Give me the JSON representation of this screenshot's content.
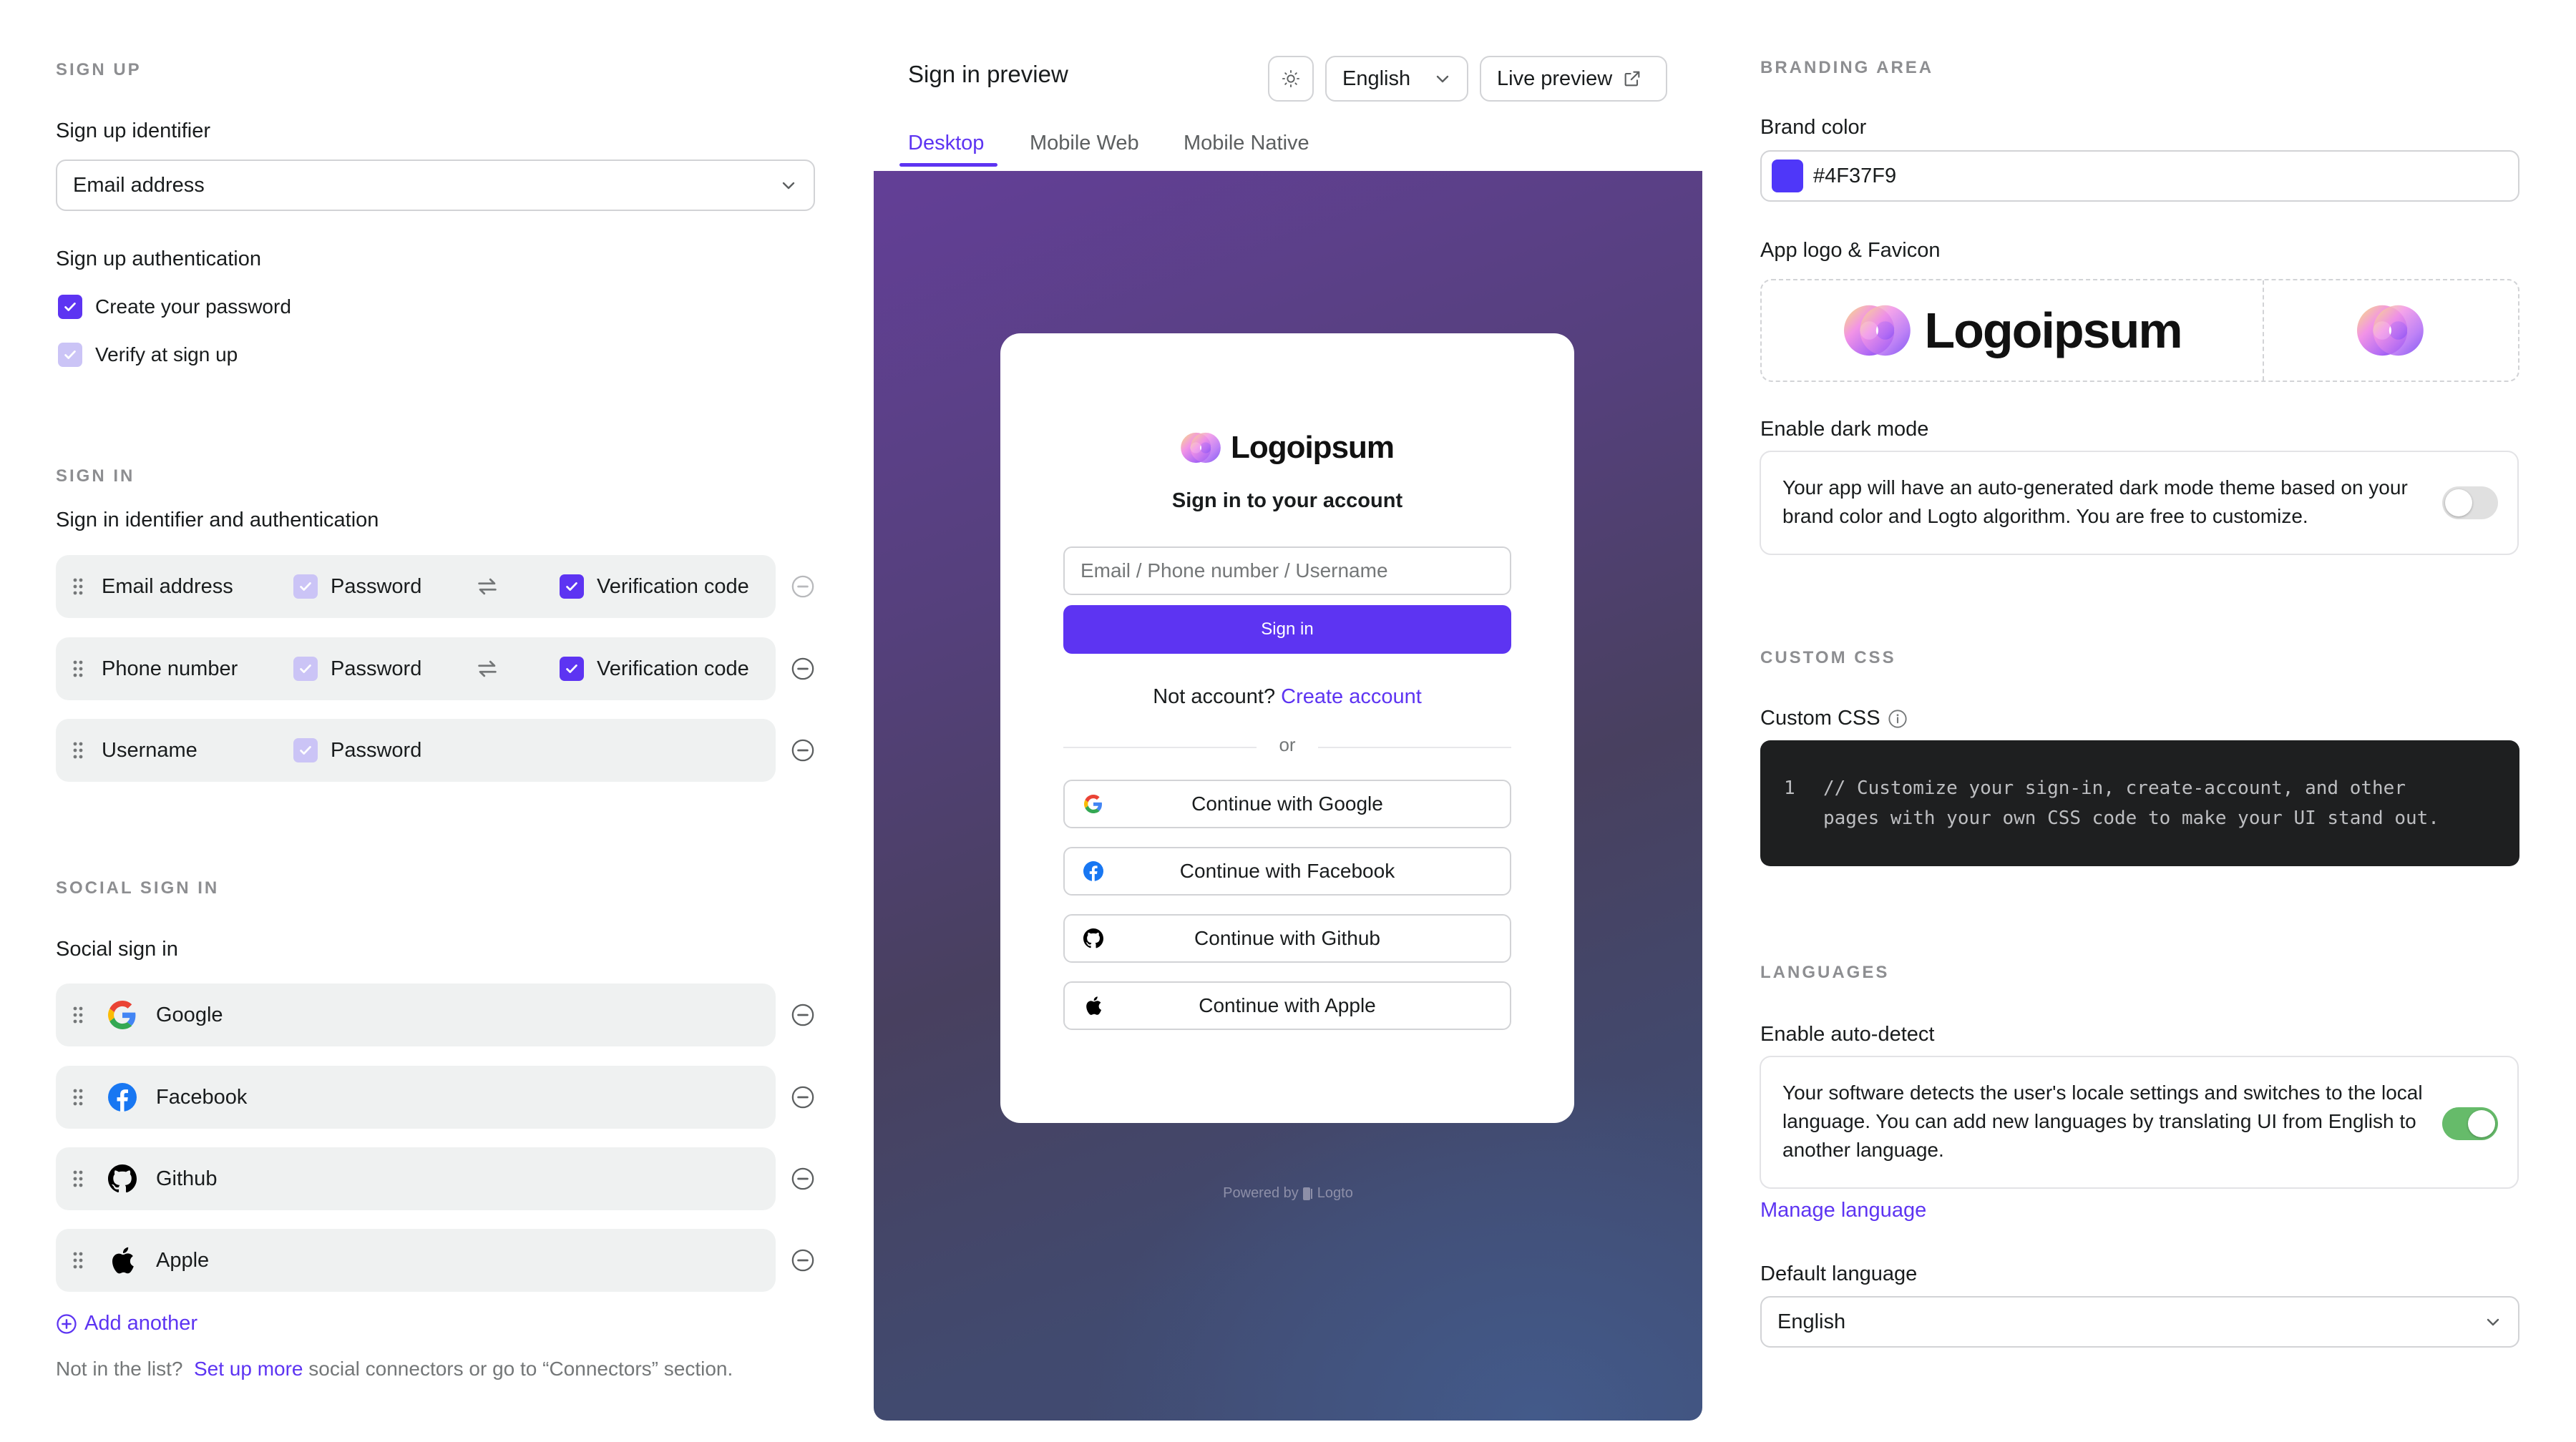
{
  "colors": {
    "brand": "#4F37F9",
    "primary_ui": "#5D34F2",
    "toggle_on": "#66BB6A",
    "toggle_off": "#E0E0E0",
    "code_bg": "#1E1F20"
  },
  "sign_up": {
    "section_label": "SIGN UP",
    "identifier_label": "Sign up identifier",
    "identifier_value": "Email address",
    "authentication_label": "Sign up authentication",
    "options": [
      {
        "label": "Create your password",
        "checked": true,
        "disabled": false
      },
      {
        "label": "Verify at sign up",
        "checked": true,
        "disabled": true
      }
    ]
  },
  "sign_in": {
    "section_label": "SIGN IN",
    "sublabel": "Sign in identifier and authentication",
    "rows": [
      {
        "identifier": "Email address",
        "password_label": "Password",
        "verification_label": "Verification code",
        "has_verification": true,
        "remove_disabled": true
      },
      {
        "identifier": "Phone number",
        "password_label": "Password",
        "verification_label": "Verification code",
        "has_verification": true,
        "remove_disabled": false
      },
      {
        "identifier": "Username",
        "password_label": "Password",
        "has_verification": false,
        "remove_disabled": false
      }
    ]
  },
  "social": {
    "section_label": "SOCIAL SIGN IN",
    "sublabel": "Social sign in",
    "items": [
      {
        "name": "Google",
        "icon": "google-icon"
      },
      {
        "name": "Facebook",
        "icon": "facebook-icon"
      },
      {
        "name": "Github",
        "icon": "github-icon"
      },
      {
        "name": "Apple",
        "icon": "apple-icon"
      }
    ],
    "add_another": "Add another",
    "footnote_prefix": "Not in the list?",
    "footnote_link": "Set up more",
    "footnote_suffix": "social connectors or go to “Connectors” section."
  },
  "preview": {
    "title": "Sign in preview",
    "theme_icon": "sun-icon",
    "language": "English",
    "live_preview": "Live preview",
    "tabs": [
      {
        "label": "Desktop",
        "active": true
      },
      {
        "label": "Mobile Web",
        "active": false
      },
      {
        "label": "Mobile Native",
        "active": false
      }
    ],
    "card": {
      "logo_text": "Logoipsum",
      "heading": "Sign in to your account",
      "input_placeholder": "Email / Phone number / Username",
      "sign_in_button": "Sign in",
      "no_account_text": "Not account?",
      "create_account_link": "Create account",
      "divider_text": "or",
      "social_buttons": [
        {
          "label": "Continue with Google",
          "icon": "google-icon"
        },
        {
          "label": "Continue with Facebook",
          "icon": "facebook-icon"
        },
        {
          "label": "Continue with Github",
          "icon": "github-icon"
        },
        {
          "label": "Continue with Apple",
          "icon": "apple-icon"
        }
      ]
    },
    "powered_by": "Powered by",
    "powered_brand": "Logto"
  },
  "branding": {
    "section_label": "BRANDING AREA",
    "brand_color_label": "Brand color",
    "brand_color_value": "#4F37F9",
    "logo_label": "App logo & Favicon",
    "logo_text": "Logoipsum",
    "dark_mode_label": "Enable dark mode",
    "dark_mode_desc": "Your app will have an auto-generated dark mode theme based on your brand color and Logto algorithm. You are free to customize.",
    "dark_mode_enabled": false
  },
  "custom_css": {
    "section_label": "CUSTOM CSS",
    "label": "Custom CSS",
    "line_number": "1",
    "code_line1": "// Customize your sign-in, create-account, and other",
    "code_line2": "pages with your own CSS code to make your UI stand out."
  },
  "languages": {
    "section_label": "LANGUAGES",
    "auto_detect_label": "Enable auto-detect",
    "auto_detect_desc": "Your software detects the user's locale settings and switches to the local language. You can add new languages by translating UI from English to another language.",
    "auto_detect_enabled": true,
    "manage_link": "Manage language",
    "default_label": "Default language",
    "default_value": "English"
  }
}
